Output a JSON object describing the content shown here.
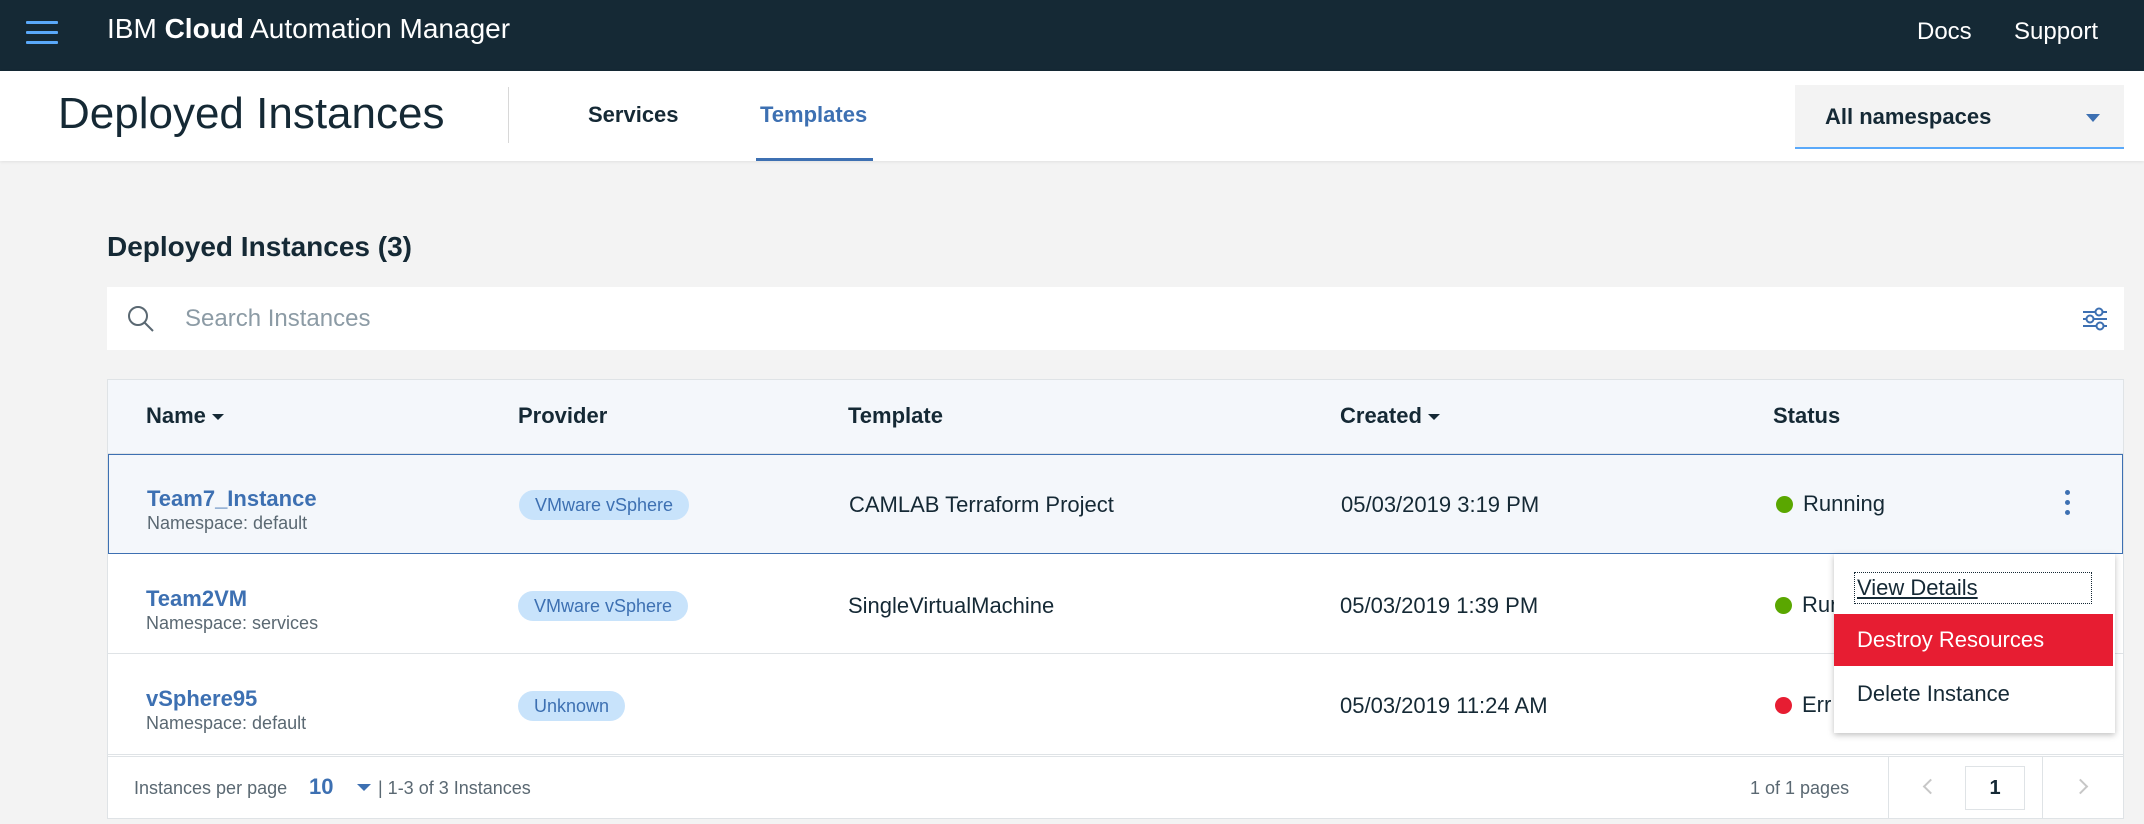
{
  "topbar": {
    "brand_prefix": "IBM ",
    "brand_bold": "Cloud",
    "brand_suffix": " Automation Manager",
    "links": [
      "Docs",
      "Support"
    ]
  },
  "header": {
    "title": "Deployed Instances",
    "tabs": [
      {
        "label": "Services",
        "active": false
      },
      {
        "label": "Templates",
        "active": true
      }
    ],
    "namespace_select": "All namespaces"
  },
  "section": {
    "title": "Deployed Instances (3)"
  },
  "search": {
    "placeholder": "Search Instances"
  },
  "table": {
    "columns": [
      "Name",
      "Provider",
      "Template",
      "Created",
      "Status"
    ],
    "rows": [
      {
        "name": "Team7_Instance",
        "namespace": "Namespace: default",
        "provider": "VMware vSphere",
        "template": "CAMLAB Terraform Project",
        "created": "05/03/2019 3:19 PM",
        "status": "Running",
        "status_color": "#5aa700",
        "selected": true
      },
      {
        "name": "Team2VM",
        "namespace": "Namespace: services",
        "provider": "VMware vSphere",
        "template": "SingleVirtualMachine",
        "created": "05/03/2019 1:39 PM",
        "status": "Run",
        "status_color": "#5aa700",
        "selected": false
      },
      {
        "name": "vSphere95",
        "namespace": "Namespace: default",
        "provider": "Unknown",
        "template": "",
        "created": "05/03/2019 11:24 AM",
        "status": "Err",
        "status_color": "#e71d32",
        "selected": false
      }
    ]
  },
  "pagination": {
    "per_page_label": "Instances per page",
    "per_page_value": "10",
    "range": "| 1-3 of 3 Instances",
    "pages": "1 of 1 pages",
    "current_page": "1"
  },
  "overflow_menu": {
    "items": [
      "View Details",
      "Destroy Resources",
      "Delete Instance"
    ]
  },
  "icons": [
    "menu-icon",
    "search-icon",
    "filter-icon",
    "overflow-menu-icon",
    "chevron-left-icon",
    "chevron-right-icon",
    "caret-down-icon"
  ],
  "colors": {
    "topbar": "#152935",
    "accent": "#3d70b2",
    "running": "#5aa700",
    "error": "#e71d32",
    "danger_menu": "#e71d32"
  }
}
